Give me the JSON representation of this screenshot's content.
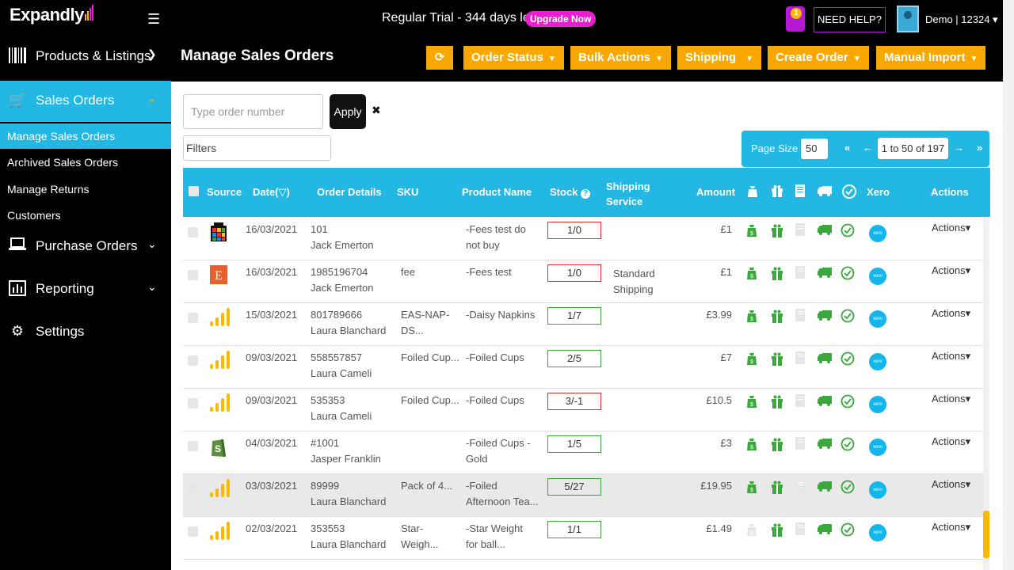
{
  "app": {
    "logo": "Expandly",
    "trial_text": "Regular Trial - 344 days left",
    "upgrade_label": "Upgrade Now",
    "notification_count": "1",
    "help_label": "NEED HELP?",
    "user_label": "Demo | 12324"
  },
  "sidebar": {
    "items": [
      {
        "label": "Products & Listings",
        "icon": "barcode-icon"
      },
      {
        "label": "Sales Orders",
        "icon": "cart-icon"
      },
      {
        "label": "Purchase Orders",
        "icon": "laptop-icon"
      },
      {
        "label": "Reporting",
        "icon": "chart-icon"
      },
      {
        "label": "Settings",
        "icon": "gears-icon"
      }
    ],
    "sub_items": [
      "Manage Sales Orders",
      "Archived Sales Orders",
      "Manage Returns",
      "Customers"
    ]
  },
  "page": {
    "title": "Manage Sales Orders",
    "refresh_icon": "refresh-icon",
    "buttons": [
      "Order Status",
      "Bulk Actions",
      "Shipping",
      "Create Order",
      "Manual Import"
    ]
  },
  "search": {
    "placeholder": "Type order number",
    "apply_label": "Apply",
    "clear_label": "✖",
    "filters_label": "Filters"
  },
  "pager": {
    "page_size_label": "Page Size",
    "page_size": "50",
    "first": "«",
    "prev": "←",
    "range": "1 to 50 of 197",
    "next": "→",
    "last": "»"
  },
  "table": {
    "headers": [
      "Source",
      "Date(▽)",
      "Order Details",
      "SKU",
      "Product Name",
      "Stock",
      "Shipping",
      "Service",
      "Amount",
      "Xero",
      "Actions"
    ],
    "actions_label": "Actions▾",
    "xero_label": "xero",
    "rows": [
      {
        "source": "rubiks",
        "date": "16/03/2021",
        "order": "101",
        "customer": "Jack Emerton",
        "sku": "",
        "sku2": "",
        "product": "-Fees test do",
        "product2": "not buy",
        "stock": "1/0",
        "stock_state": "red",
        "ship": "",
        "ship2": "",
        "amount": "£1",
        "hl": false,
        "grey_box": false
      },
      {
        "source": "etsy",
        "date": "16/03/2021",
        "order": "1985196704",
        "customer": "Jack Emerton",
        "sku": "fee",
        "sku2": "",
        "product": "-Fees test",
        "product2": "",
        "stock": "1/0",
        "stock_state": "red",
        "ship": "Standard",
        "ship2": "Shipping",
        "amount": "£1",
        "hl": false,
        "grey_box": false
      },
      {
        "source": "expandly",
        "date": "15/03/2021",
        "order": "801789666",
        "customer": "Laura Blanchard",
        "sku": "EAS-NAP-",
        "sku2": "DS...",
        "product": "-Daisy Napkins",
        "product2": "",
        "stock": "1/7",
        "stock_state": "green",
        "ship": "",
        "ship2": "",
        "amount": "£3.99",
        "hl": false,
        "grey_box": false
      },
      {
        "source": "expandly",
        "date": "09/03/2021",
        "order": "558557857",
        "customer": "Laura Cameli",
        "sku": "Foiled Cup...",
        "sku2": "",
        "product": "-Foiled Cups",
        "product2": "",
        "stock": "2/5",
        "stock_state": "green",
        "ship": "",
        "ship2": "",
        "amount": "£7",
        "hl": false,
        "grey_box": false
      },
      {
        "source": "expandly",
        "date": "09/03/2021",
        "order": "535353",
        "customer": "Laura Cameli",
        "sku": "Foiled Cup...",
        "sku2": "",
        "product": "-Foiled Cups",
        "product2": "",
        "stock": "3/-1",
        "stock_state": "red",
        "ship": "",
        "ship2": "",
        "amount": "£10.5",
        "hl": false,
        "grey_box": false
      },
      {
        "source": "shopify",
        "date": "04/03/2021",
        "order": "#1001",
        "customer": "Jasper Franklin",
        "sku": "",
        "sku2": "",
        "product": "-Foiled Cups -",
        "product2": "Gold",
        "stock": "1/5",
        "stock_state": "green",
        "ship": "",
        "ship2": "",
        "amount": "£3",
        "hl": false,
        "grey_box": false
      },
      {
        "source": "expandly",
        "date": "03/03/2021",
        "order": "89999",
        "customer": "Laura Blanchard",
        "sku": "Pack of 4...",
        "sku2": "",
        "product": "-Foiled",
        "product2": "Afternoon Tea...",
        "stock": "5/27",
        "stock_state": "green",
        "ship": "",
        "ship2": "",
        "amount": "£19.95",
        "hl": true,
        "grey_box": false
      },
      {
        "source": "expandly",
        "date": "02/03/2021",
        "order": "353553",
        "customer": "Laura Blanchard",
        "sku": "Star-",
        "sku2": "Weigh...",
        "product": "-Star Weight",
        "product2": "for ball...",
        "stock": "1/1",
        "stock_state": "green",
        "ship": "",
        "ship2": "",
        "amount": "£1.49",
        "hl": false,
        "grey_box": true
      }
    ]
  },
  "colors": {
    "accent": "#22b8e3",
    "orange": "#f8a800",
    "magenta": "#e91ece",
    "green": "#3aa83a",
    "red": "#e03030"
  }
}
